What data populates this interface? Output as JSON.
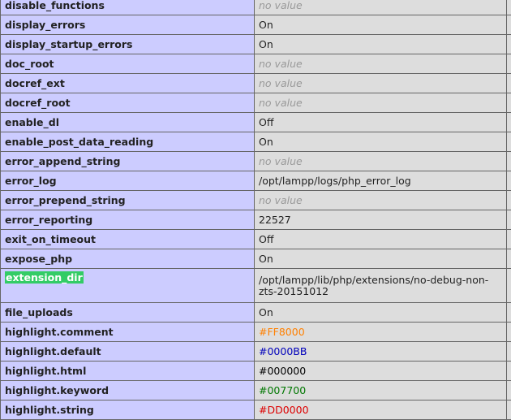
{
  "directives": [
    {
      "name": "disable_functions",
      "value": "no value",
      "no_value": true
    },
    {
      "name": "display_errors",
      "value": "On"
    },
    {
      "name": "display_startup_errors",
      "value": "On"
    },
    {
      "name": "doc_root",
      "value": "no value",
      "no_value": true
    },
    {
      "name": "docref_ext",
      "value": "no value",
      "no_value": true
    },
    {
      "name": "docref_root",
      "value": "no value",
      "no_value": true
    },
    {
      "name": "enable_dl",
      "value": "Off"
    },
    {
      "name": "enable_post_data_reading",
      "value": "On"
    },
    {
      "name": "error_append_string",
      "value": "no value",
      "no_value": true
    },
    {
      "name": "error_log",
      "value": "/opt/lampp/logs/php_error_log"
    },
    {
      "name": "error_prepend_string",
      "value": "no value",
      "no_value": true
    },
    {
      "name": "error_reporting",
      "value": "22527"
    },
    {
      "name": "exit_on_timeout",
      "value": "Off"
    },
    {
      "name": "expose_php",
      "value": "On"
    },
    {
      "name": "extension_dir",
      "value": "/opt/lampp/lib/php/extensions/no-debug-non-zts-20151012",
      "highlighted": true
    },
    {
      "name": "file_uploads",
      "value": "On"
    },
    {
      "name": "highlight.comment",
      "value": "#FF8000",
      "color": "#FF8000"
    },
    {
      "name": "highlight.default",
      "value": "#0000BB",
      "color": "#0000BB"
    },
    {
      "name": "highlight.html",
      "value": "#000000",
      "color": "#000000"
    },
    {
      "name": "highlight.keyword",
      "value": "#007700",
      "color": "#007700"
    },
    {
      "name": "highlight.string",
      "value": "#DD0000",
      "color": "#DD0000"
    }
  ],
  "colors": {
    "name_cell_bg": "#ccccff",
    "value_cell_bg": "#dddddd",
    "no_value_text": "#999999",
    "selection_highlight": "#33cc66"
  }
}
